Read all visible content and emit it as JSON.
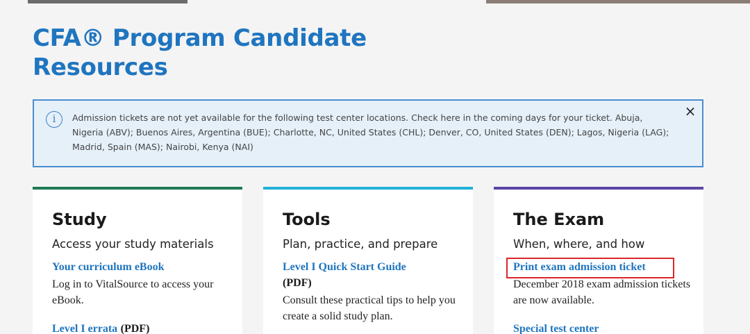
{
  "page": {
    "title_line1": "CFA® Program Candidate",
    "title_line2": "Resources"
  },
  "alert": {
    "icon": "info-icon",
    "text": "Admission tickets are not yet available for the following test center locations. Check here in the coming days for your ticket. Abuja, Nigeria (ABV); Buenos Aires, Argentina (BUE); Charlotte, NC, United States (CHL); Denver, CO, United States (DEN); Lagos, Nigeria (LAG); Madrid, Spain (MAS); Nairobi, Kenya (NAI)",
    "close_icon": "close-icon",
    "close_label": "×"
  },
  "cards": [
    {
      "title": "Study",
      "subtitle": "Access your study materials",
      "accent": "#1e7a52",
      "link1": "Your curriculum eBook",
      "desc1": "Log in to VitalSource to access your eBook.",
      "link2": "Level I errata",
      "link2_suffix": "(PDF)"
    },
    {
      "title": "Tools",
      "subtitle": "Plan, practice, and prepare",
      "accent": "#22b0d8",
      "link1": "Level I Quick Start Guide",
      "link1_suffix": "(PDF)",
      "desc1": "Consult these practical tips to help you create a solid study plan."
    },
    {
      "title": "The Exam",
      "subtitle": "When, where, and how",
      "accent": "#5b44a6",
      "link1": "Print exam admission ticket",
      "desc1": "December 2018 exam admission tickets are now available.",
      "link2": "Special test center"
    }
  ],
  "colors": {
    "brand_blue": "#1f75bf",
    "alert_bg": "#e5f0f9",
    "alert_border": "#4a8ecf",
    "highlight_red": "#d9262b"
  }
}
